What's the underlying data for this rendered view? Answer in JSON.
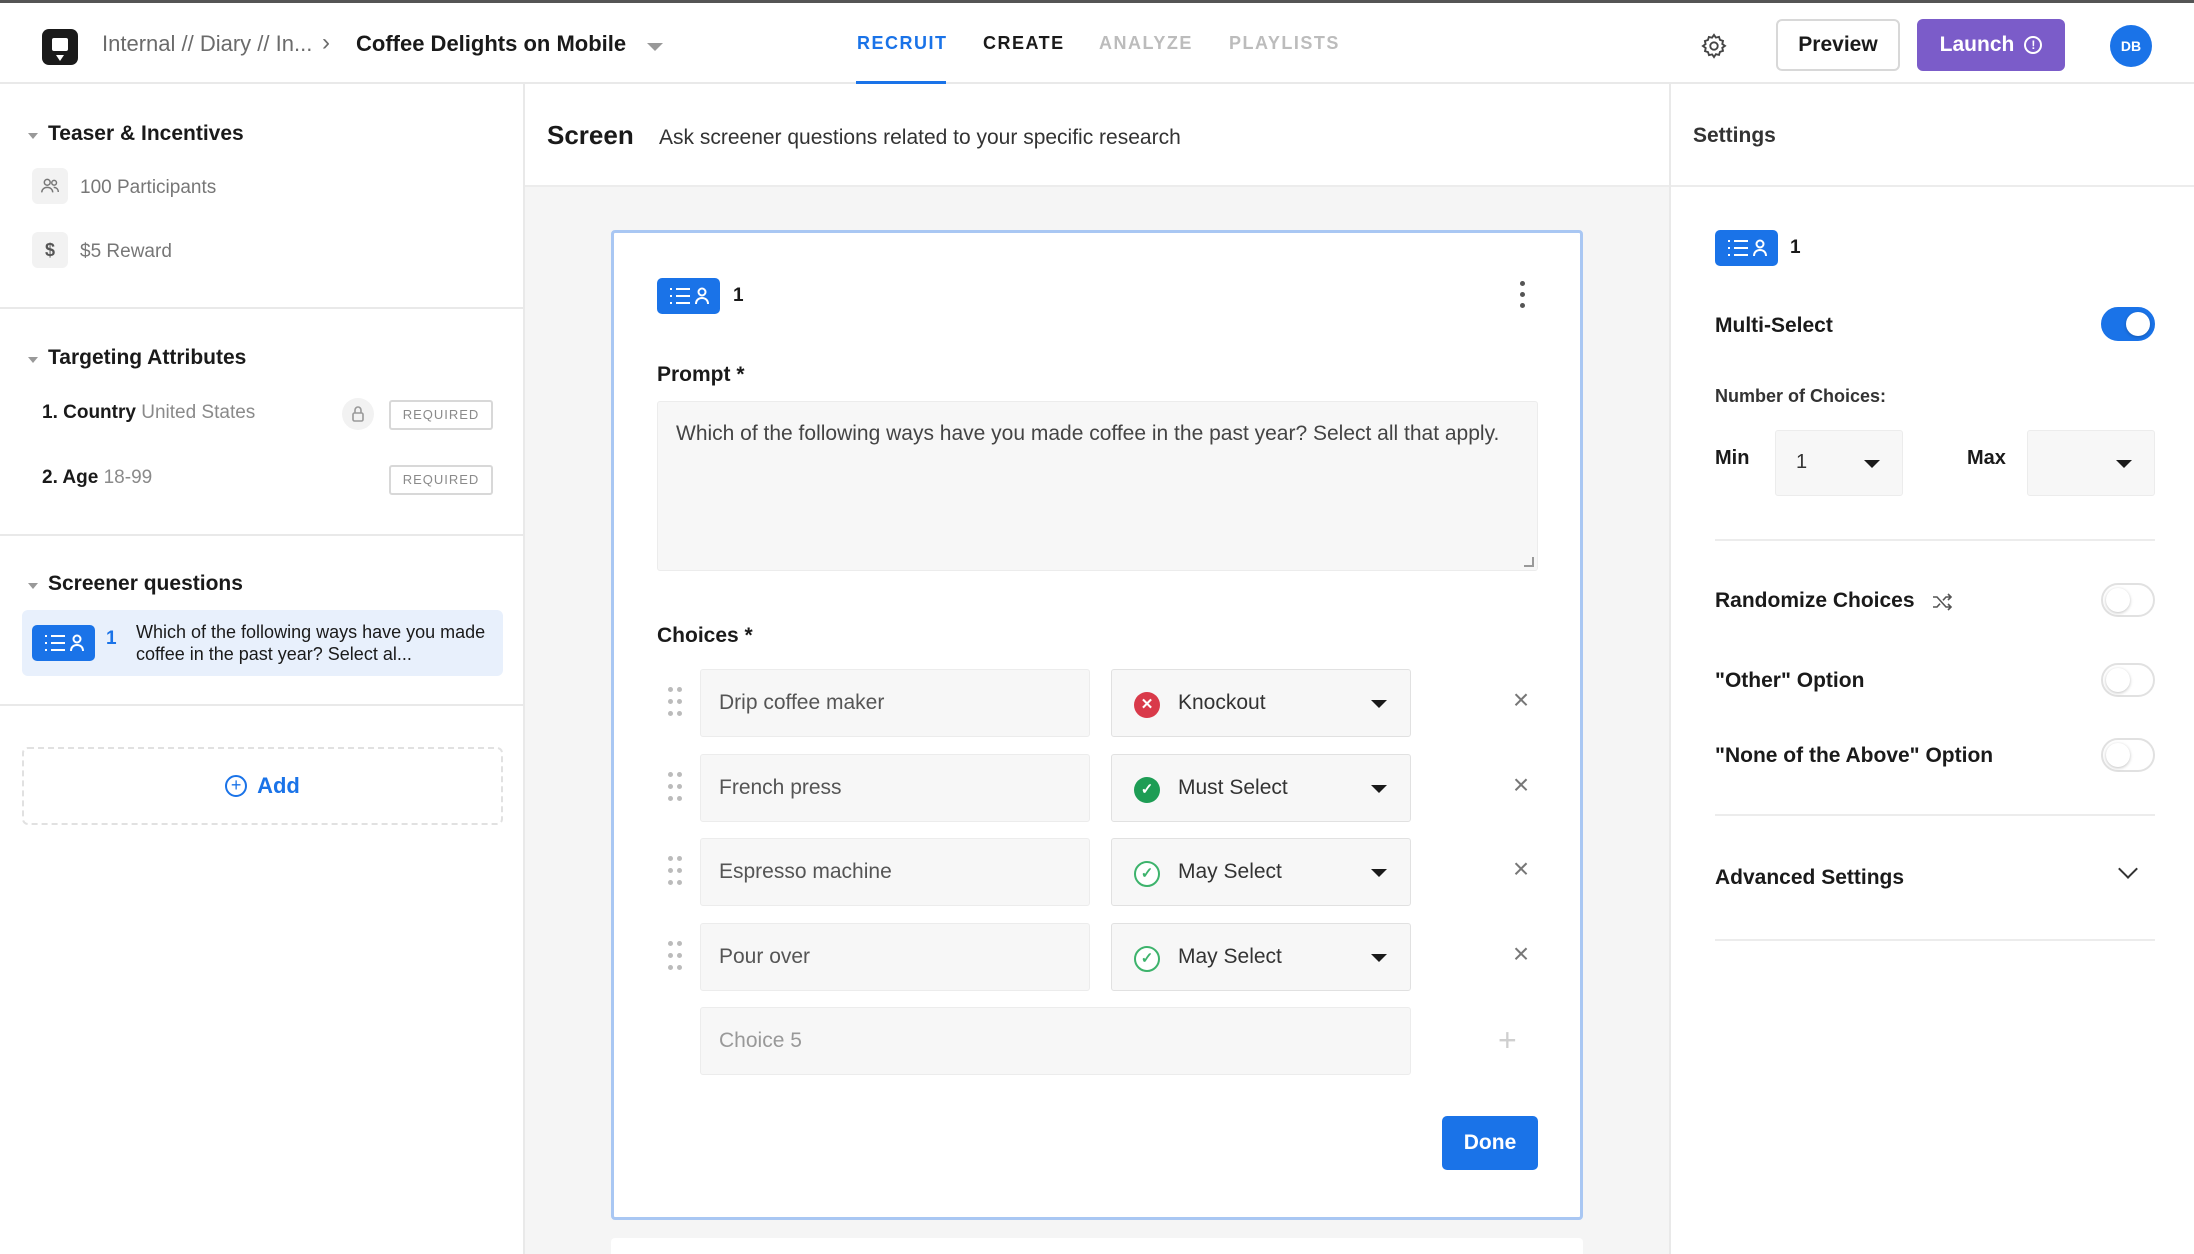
{
  "header": {
    "breadcrumb_parent": "Internal // Diary // In...",
    "breadcrumb_separator": "›",
    "project_title": "Coffee Delights on Mobile",
    "tabs": [
      "RECRUIT",
      "CREATE",
      "ANALYZE",
      "PLAYLISTS"
    ],
    "active_tab": "RECRUIT",
    "preview_label": "Preview",
    "launch_label": "Launch",
    "avatar_initials": "DB"
  },
  "sidebar": {
    "teaser": {
      "title": "Teaser & Incentives",
      "participants": "100 Participants",
      "reward_icon": "$",
      "reward": "$5 Reward"
    },
    "targeting": {
      "title": "Targeting Attributes",
      "items": [
        {
          "label": "1. Country",
          "value": "United States",
          "badge": "REQUIRED",
          "locked": true
        },
        {
          "label": "2. Age",
          "value": "18-99",
          "badge": "REQUIRED",
          "locked": false
        }
      ]
    },
    "screener": {
      "title": "Screener questions",
      "items": [
        {
          "number": "1",
          "text": "Which of the following ways have you made coffee in the past year? Select al..."
        }
      ]
    },
    "add_label": "Add"
  },
  "main": {
    "title": "Screen",
    "description": "Ask screener questions related to your specific research",
    "question": {
      "number": "1",
      "prompt_label": "Prompt *",
      "prompt_value": "Which of the following ways have you made coffee in the past year? Select all that apply.",
      "choices_label": "Choices *",
      "choices": [
        {
          "text": "Drip coffee maker",
          "rule": "Knockout",
          "rule_type": "knockout"
        },
        {
          "text": "French press",
          "rule": "Must Select",
          "rule_type": "must"
        },
        {
          "text": "Espresso machine",
          "rule": "May Select",
          "rule_type": "may"
        },
        {
          "text": "Pour over",
          "rule": "May Select",
          "rule_type": "may"
        }
      ],
      "new_choice_placeholder": "Choice 5",
      "done_label": "Done"
    }
  },
  "settings": {
    "title": "Settings",
    "question_number": "1",
    "multi_select_label": "Multi-Select",
    "multi_select_on": true,
    "number_of_choices_label": "Number of Choices:",
    "min_label": "Min",
    "min_value": "1",
    "max_label": "Max",
    "max_value": "",
    "randomize_label": "Randomize Choices",
    "randomize_on": false,
    "other_label": "\"Other\" Option",
    "other_on": false,
    "none_label": "\"None of the Above\" Option",
    "none_on": false,
    "advanced_label": "Advanced Settings"
  },
  "colors": {
    "accent": "#1a73e8",
    "launch": "#7b5cc9",
    "knockout": "#d93a4a",
    "must_select": "#1e9d55",
    "may_select": "#3db36c"
  }
}
